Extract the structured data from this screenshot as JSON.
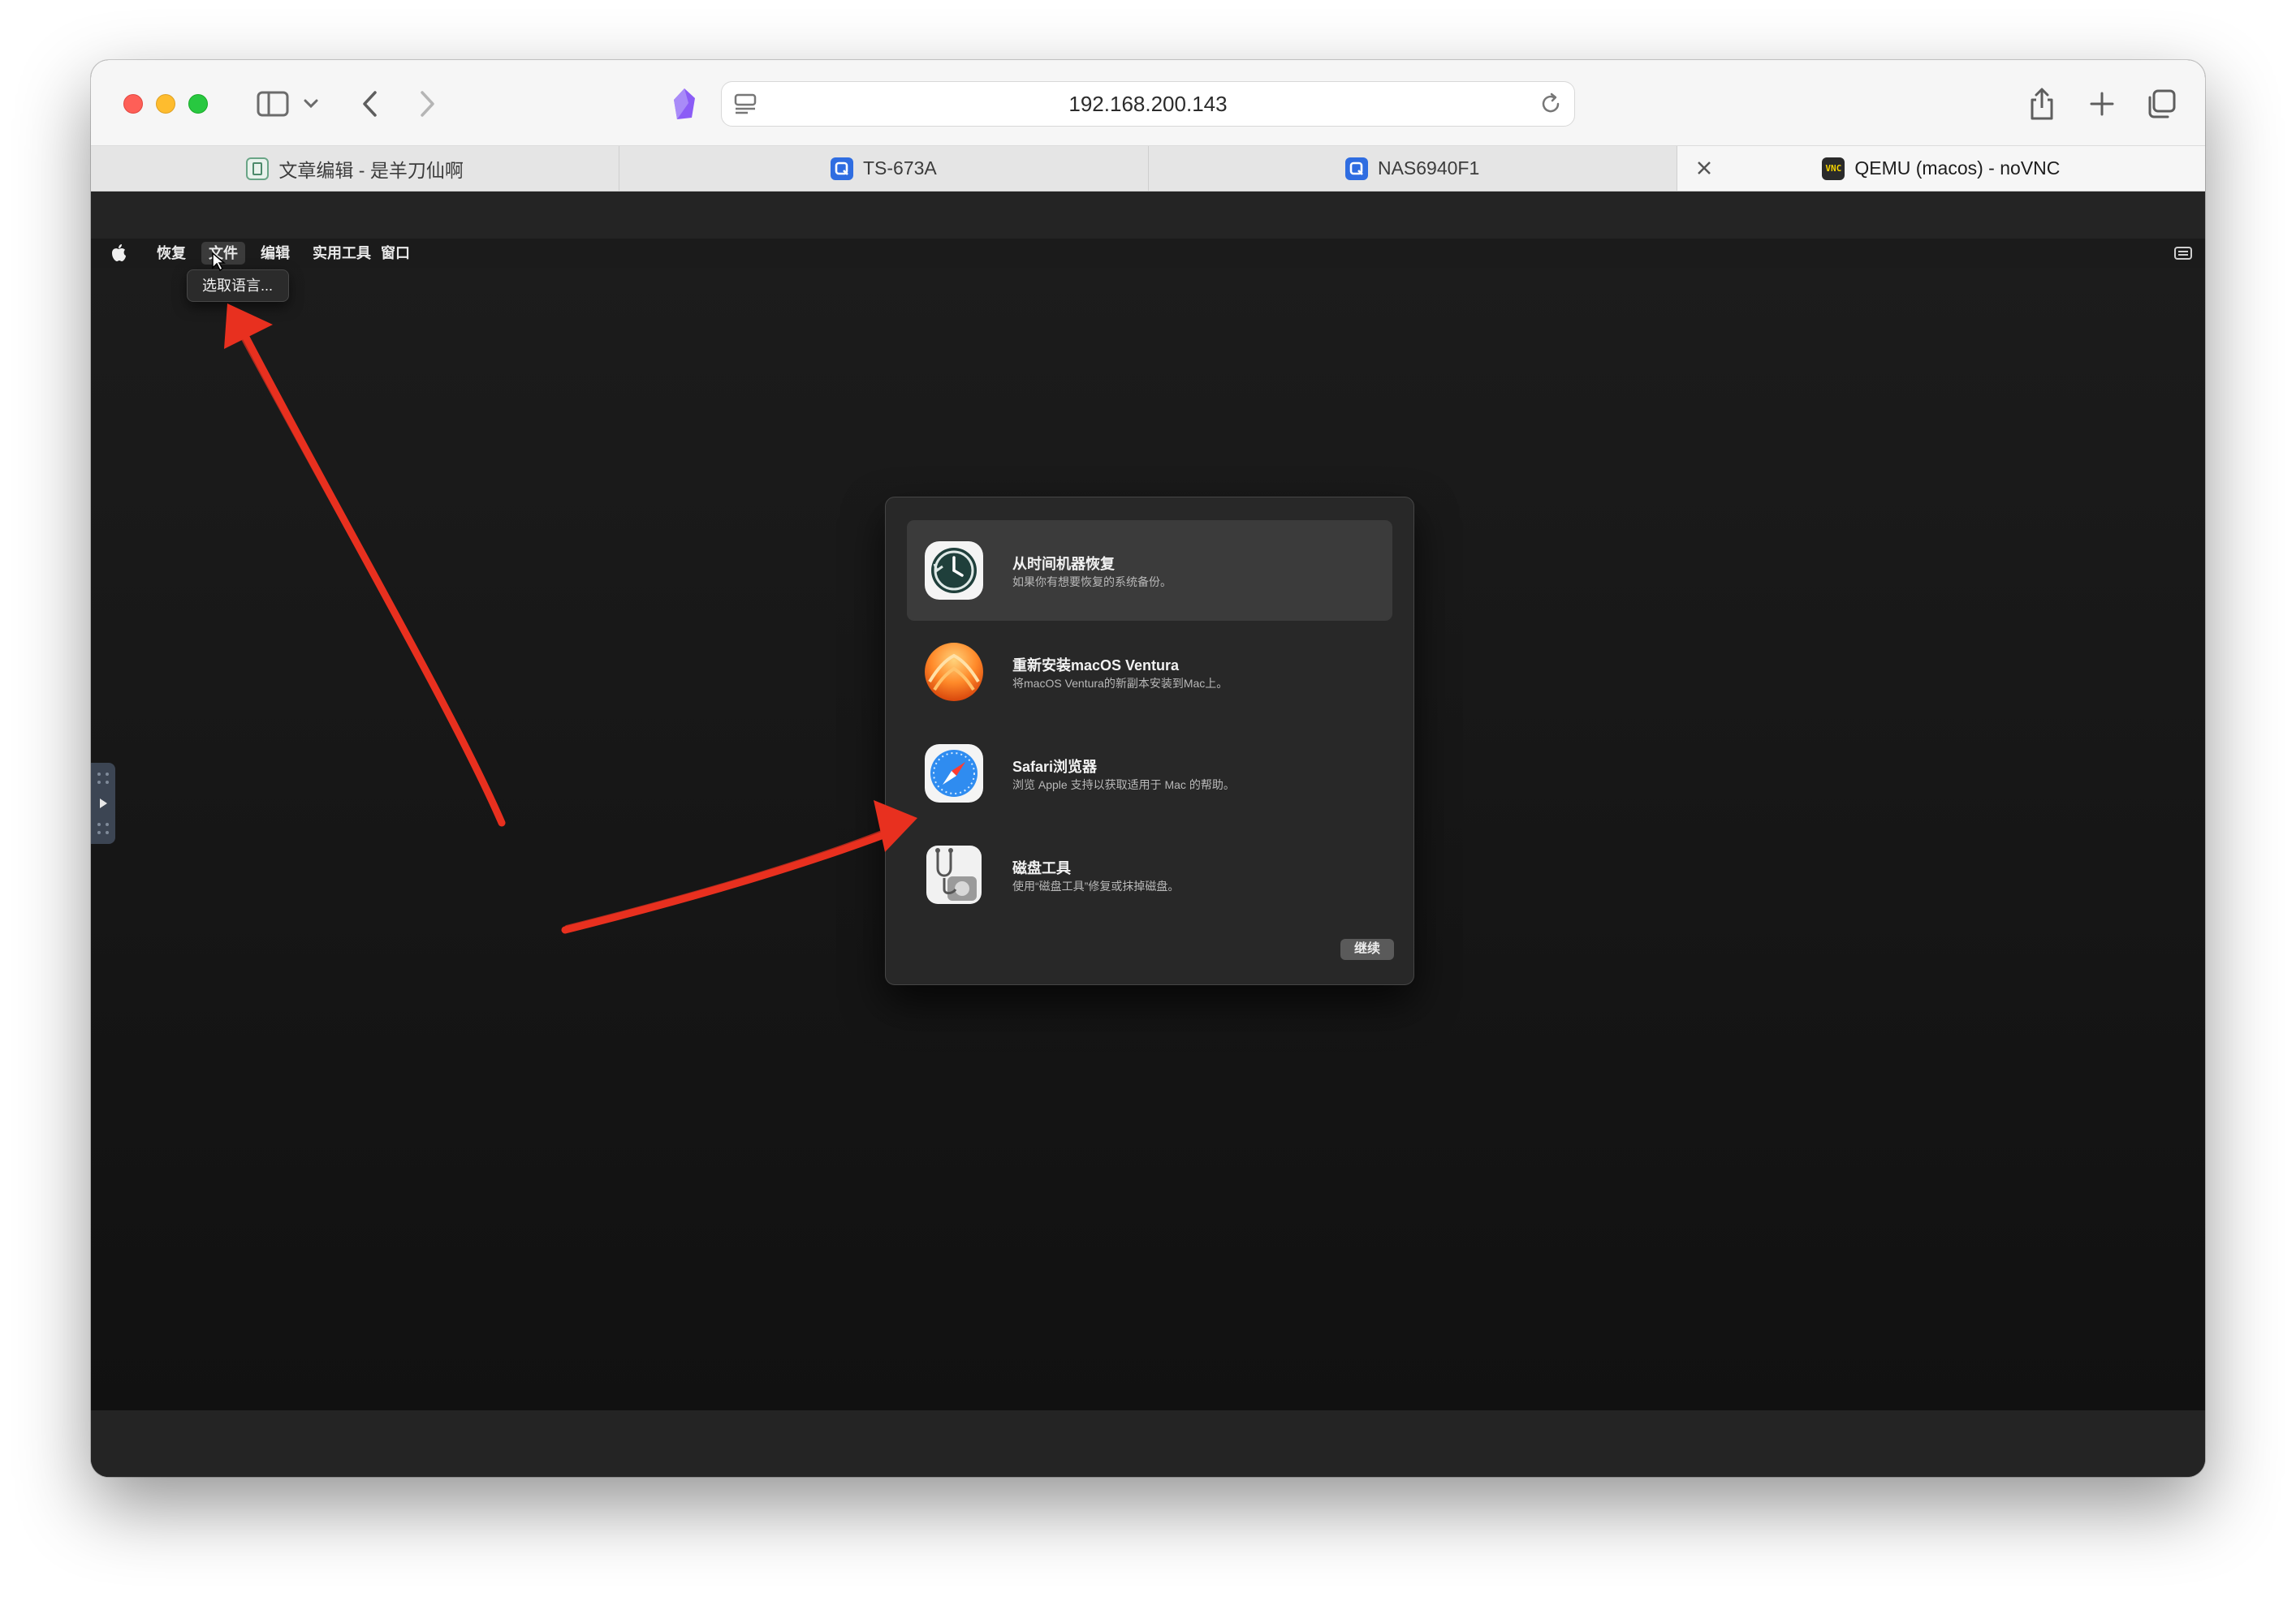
{
  "browser": {
    "url": "192.168.200.143",
    "tabs": [
      {
        "label": "文章编辑 - 是羊刀仙啊",
        "favicon": "document-icon"
      },
      {
        "label": "TS-673A",
        "favicon": "qnap-icon"
      },
      {
        "label": "NAS6940F1",
        "favicon": "qnap-icon"
      },
      {
        "label": "QEMU (macos) - noVNC",
        "favicon": "vnc-icon",
        "favicon_text": "VNC",
        "active": true
      }
    ]
  },
  "menubar": {
    "items": [
      "恢复",
      "文件",
      "编辑",
      "实用工具",
      "窗口"
    ],
    "active_item": "文件"
  },
  "dropdown": {
    "item": "选取语言..."
  },
  "recovery": {
    "options": [
      {
        "title": "从时间机器恢复",
        "description": "如果你有想要恢复的系统备份。",
        "icon": "time-machine-icon",
        "selected": true
      },
      {
        "title": "重新安装macOS Ventura",
        "description": "将macOS Ventura的新副本安装到Mac上。",
        "icon": "macos-ventura-icon"
      },
      {
        "title": "Safari浏览器",
        "description": "浏览 Apple 支持以获取适用于 Mac 的帮助。",
        "icon": "safari-icon"
      },
      {
        "title": "磁盘工具",
        "description": "使用“磁盘工具”修复或抹掉磁盘。",
        "icon": "disk-utility-icon"
      }
    ],
    "continue_label": "继续"
  },
  "colors": {
    "annotation_arrow": "#e8301f",
    "traffic_close": "#fe5f57",
    "traffic_minimize": "#febc2e",
    "traffic_zoom": "#28c840",
    "dialog_background": "#282828"
  }
}
